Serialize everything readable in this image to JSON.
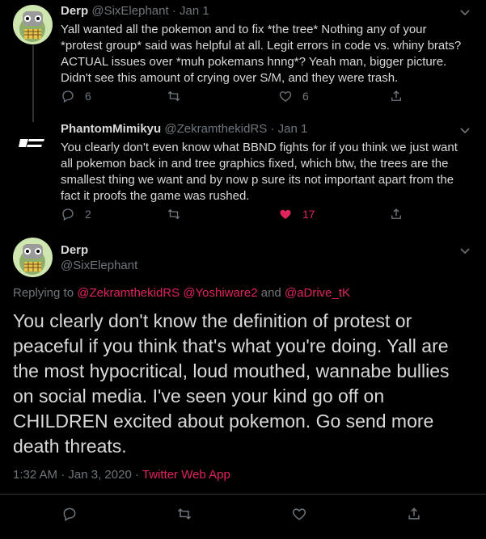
{
  "tweet1": {
    "name": "Derp",
    "handle": "@SixElephant",
    "sep": "·",
    "date": "Jan 1",
    "lines": [
      "Yall wanted all the pokemon and to fix *the tree* Nothing any of your",
      "*protest group* said was helpful at all. Legit errors in code vs. whiny brats?",
      "ACTUAL issues over *muh pokemans hnng*? Yeah man, bigger picture.",
      "Didn't see this amount of crying over S/M, and they were trash."
    ],
    "reply_count": "6",
    "retweet_count": "",
    "like_count": "6"
  },
  "tweet2": {
    "name": "PhantomMimikyu",
    "handle": "@ZekramthekidRS",
    "sep": "·",
    "date": "Jan 1",
    "lines": [
      "You clearly don't even know what BBND fights for if you think we just want",
      "all pokemon back in and tree graphics fixed, which btw, the trees are the",
      "smallest thing we want and by now p sure its not important apart from the",
      "fact it proofs the game was rushed."
    ],
    "reply_count": "2",
    "retweet_count": "",
    "like_count": "17",
    "like_color": "#e0245e"
  },
  "main": {
    "name": "Derp",
    "handle": "@SixElephant",
    "replying_prefix": "Replying to ",
    "mention1": "@ZekramthekidRS",
    "mention2": "@Yoshiware2",
    "and": " and ",
    "mention3": "@aDrive_tK",
    "lines": [
      "You clearly don't know the definition of protest or",
      "peaceful if you think that's what you're doing. Yall are",
      "the most hypocritical, loud mouthed, wannabe bullies",
      "on social media. I've seen your kind go off on",
      "CHILDREN excited about pokemon. Go send more",
      "death threats."
    ],
    "time": "1:32 AM",
    "sep": " · ",
    "date": "Jan 3, 2020",
    "sep2": " · ",
    "source": "Twitter Web App"
  },
  "colors": {
    "accent": "#e0245e",
    "muted": "#6e767d",
    "text": "#d9d9d9",
    "bg": "#000000"
  }
}
